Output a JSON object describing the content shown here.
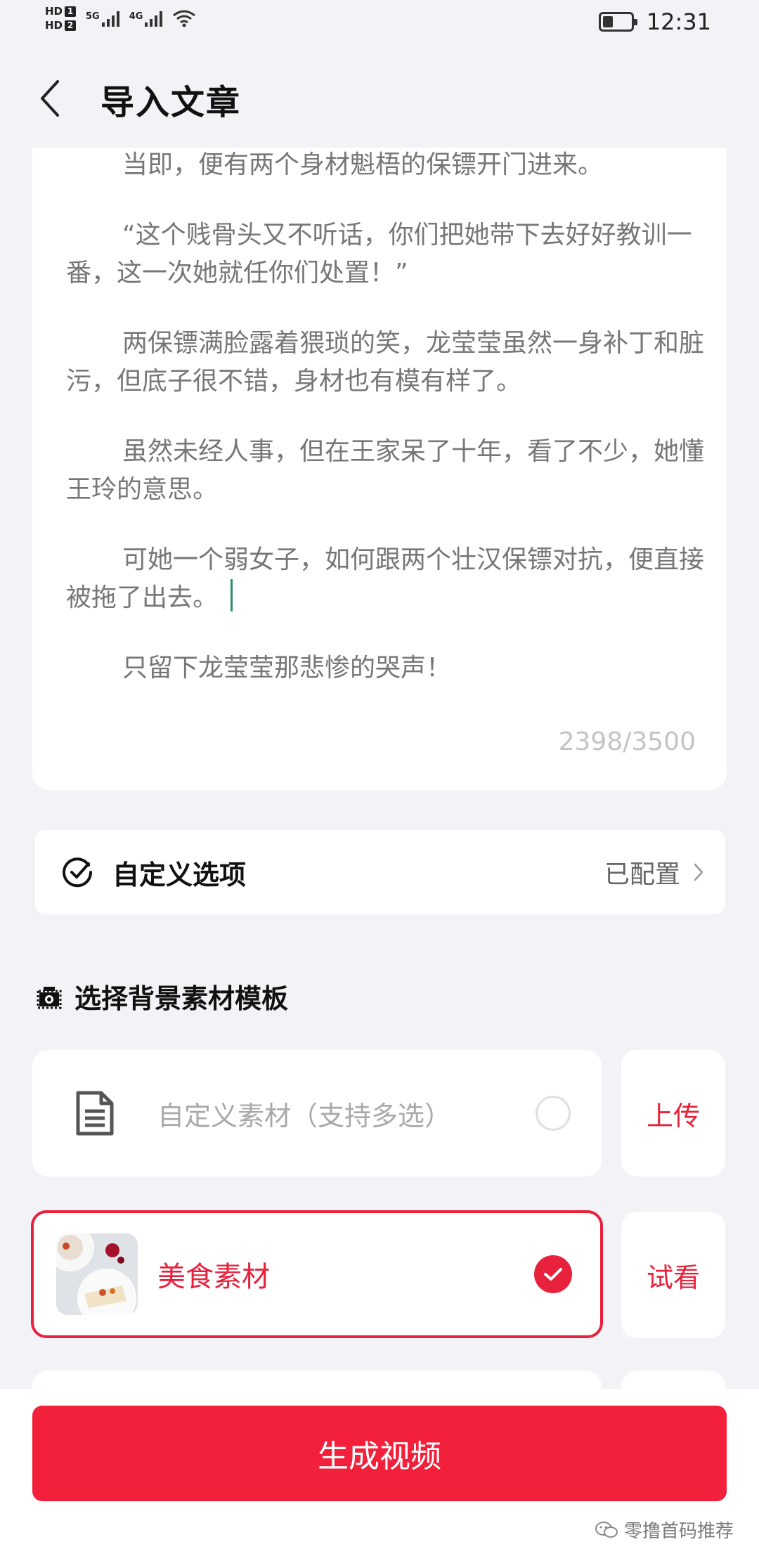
{
  "status_bar": {
    "sim1": "HD",
    "sim1_num": "1",
    "sim2": "HD",
    "sim2_num": "2",
    "net1": "5G",
    "net2": "4G",
    "time": "12:31",
    "icons": [
      "signal-icon",
      "wifi-icon",
      "battery-icon"
    ]
  },
  "header": {
    "title": "导入文章",
    "back_icon": "chevron-left-icon"
  },
  "article": {
    "paragraphs": [
      "当即，便有两个身材魁梧的保镖开门进来。",
      "“这个贱骨头又不听话，你们把她带下去好好教训一番，这一次她就任你们处置！”",
      "两保镖满脸露着猥琐的笑，龙莹莹虽然一身补丁和脏污，但底子很不错，身材也有模有样了。",
      "虽然未经人事，但在王家呆了十年，看了不少，她懂王玲的意思。",
      "可她一个弱女子，如何跟两个壮汉保镖对抗，便直接被拖了出去。",
      "只留下龙莹莹那悲惨的哭声！"
    ],
    "counter": "2398/3500"
  },
  "custom_options": {
    "label": "自定义选项",
    "status": "已配置",
    "icon": "check-circle-icon"
  },
  "background_section": {
    "title": "选择背景素材模板",
    "icon": "camera-icon"
  },
  "materials": [
    {
      "label": "自定义素材（支持多选）",
      "action": "上传",
      "selected": false
    },
    {
      "label": "美食素材",
      "action": "试看",
      "selected": true
    }
  ],
  "generate_button": "生成视频",
  "watermark": "零撸首码推荐",
  "colors": {
    "accent": "#e8213c",
    "button": "#f2203a",
    "background": "#f2f2f7",
    "cursor": "#2e8b73"
  }
}
